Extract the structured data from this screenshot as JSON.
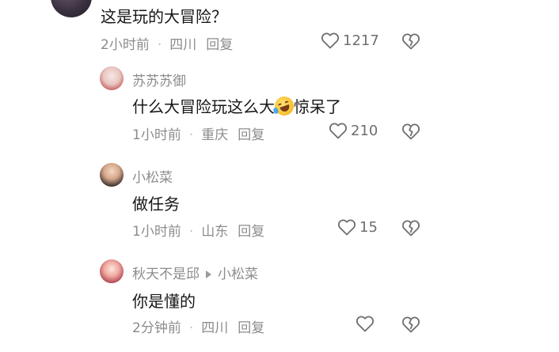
{
  "comments": [
    {
      "text": "这是玩的大冒险？",
      "time": "2小时前",
      "location": "四川",
      "reply_label": "回复",
      "likes": "1217"
    }
  ],
  "replies": [
    {
      "author": "苏苏苏御",
      "text_before_emoji": "什么大冒险玩这么大",
      "emoji": "rolling-on-floor-laughing",
      "text_after_emoji": "惊呆了",
      "time": "1小时前",
      "location": "重庆",
      "reply_label": "回复",
      "likes": "210"
    },
    {
      "author": "小松菜",
      "text": "做任务",
      "time": "1小时前",
      "location": "山东",
      "reply_label": "回复",
      "likes": "15"
    },
    {
      "author": "秋天不是邱",
      "reply_to": "小松菜",
      "text": "你是懂的",
      "time": "2分钟前",
      "location": "四川",
      "reply_label": "回复",
      "likes": ""
    }
  ],
  "separator": "·",
  "icons": {
    "like": "heart-outline-icon",
    "dislike": "broken-heart-icon",
    "reply_to": "play-arrow-icon"
  },
  "colors": {
    "text": "#161616",
    "meta": "#8c8c8c",
    "icon": "#6f6f6f"
  }
}
